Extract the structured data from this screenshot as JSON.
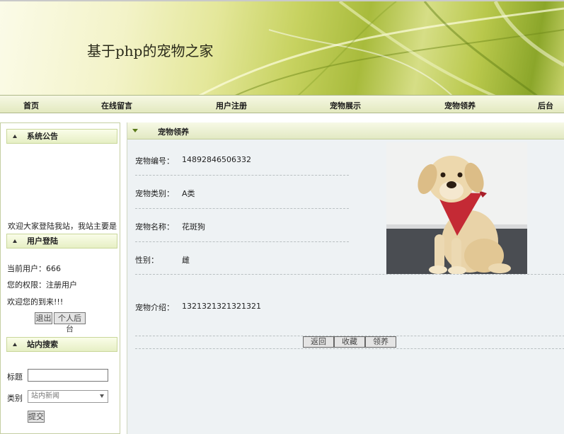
{
  "site": {
    "title": "基于php的宠物之家"
  },
  "nav": {
    "items": [
      {
        "label": "首页"
      },
      {
        "label": "在线留言"
      },
      {
        "label": "用户注册"
      },
      {
        "label": "宠物展示"
      },
      {
        "label": "宠物领养"
      },
      {
        "label": "后台"
      }
    ]
  },
  "sidebar": {
    "announce": {
      "title": "系统公告",
      "text": "欢迎大家登陆我站，我站主要是"
    },
    "login": {
      "title": "用户登陆",
      "user_line": "当前用户：666",
      "role_line": "您的权限：注册用户",
      "welcome": "欢迎您的到来!!!",
      "logout_label": "退出",
      "personal_label": "个人后台"
    },
    "search": {
      "title": "站内搜索",
      "title_label": "标题",
      "title_value": "",
      "type_label": "类别",
      "type_selected": "站内新闻",
      "submit_label": "提交"
    }
  },
  "main": {
    "header": "宠物领养",
    "fields": {
      "id_label": "宠物编号：",
      "id_value": "14892846506332",
      "category_label": "宠物类别：",
      "category_value": "A类",
      "name_label": "宠物名称：",
      "name_value": "花斑狗",
      "gender_label": "性别：",
      "gender_value": "雌",
      "intro_label": "宠物介绍：",
      "intro_value": "1321321321321321"
    },
    "buttons": {
      "back": "返回",
      "favorite": "收藏",
      "adopt": "领养"
    },
    "photo_icon": "dog-photo"
  },
  "colors": {
    "accent_green": "#b9c84c",
    "header_bg": "#e6efc4",
    "main_bg": "#eef2f4"
  }
}
